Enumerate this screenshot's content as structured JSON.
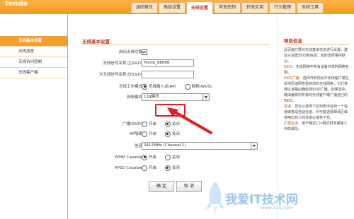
{
  "brand": "Tenda",
  "nav_tabs": [
    "返回首页",
    "高级设置",
    "无线设置",
    "带宽控制",
    "转发应用",
    "行为管理",
    "系统工具"
  ],
  "nav_active_index": 2,
  "sidebar": [
    "无线基本设置",
    "无线加密",
    "无线访问控制",
    "无线客户端"
  ],
  "sidebar_active_index": 0,
  "section_title": "无线基本设置",
  "form": {
    "enable_label": "启用无线功能",
    "ssid_label": "无线信号名称(主SSID)",
    "ssid_value": "Tenda_88888",
    "ssid2_label": "次无线信号名称(次SSID)",
    "mode_label": "无线工作模式",
    "mode_opt1": "无线接入点(AP)",
    "mode_opt2": "网桥(WDS)",
    "net_label": "网络模式",
    "net_value": "11g模式",
    "bcast_label": "广播(SSID)",
    "on": "开启",
    "off": "关闭",
    "ap_iso_label": "AP隔离",
    "channel_label": "信道",
    "channel_value": "2412MHz (Channel 1)",
    "wmm_label": "WMM Capable",
    "apsd_label": "APSD Capable",
    "ok": "确 定",
    "cancel": "取 消"
  },
  "help": {
    "title": "帮助信息",
    "p1": "此页面只要对无线基本信息进行设置，建议只设置SSID和信道，其他选项保持默认。",
    "ssid_key": "SSID：",
    "ssid_desc": "无线网络中所有设备共享的网络名称。",
    "bcast_key": "SSID广播：",
    "bcast_desc": "选择开启则允许无线客户端在本地区域网查看到您的无线网络，它们将通过该路由器检测SSID广播。如果选中，路由器将向所有的无线客户端广播自己的SSID。",
    "chan_key": "信道：",
    "chan_desc": "您可以选择下拉列表中任何一个信道或者是自动信道，尽可能选择相邻区域使用比较少的信道以避免干扰。",
    "mode_key": "扩展信道：",
    "mode_desc": "用于确定11n模式时本网络工作的频段。"
  },
  "watermark": "我爱IT技术网",
  "watermark_sub": "www.52ij.com",
  "colors": {
    "accent": "#f29a1f",
    "highlight": "#e01e1e"
  }
}
